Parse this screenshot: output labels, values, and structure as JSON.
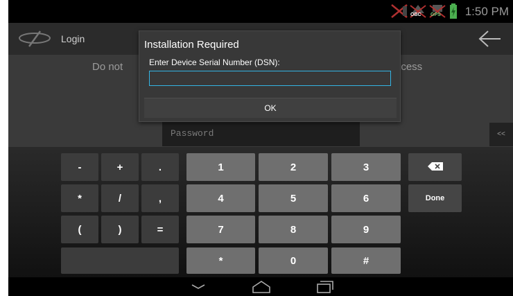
{
  "status_bar": {
    "time": "1:50 PM",
    "icons": [
      "signal-off-icon",
      "obc-icon",
      "gps-icon",
      "battery-icon"
    ],
    "obc_label": "OBC",
    "gps_label": "GPS"
  },
  "action_bar": {
    "title": "Login"
  },
  "content": {
    "hint_left": "Do not",
    "hint_right": "rocess",
    "password_placeholder": "Password",
    "collapse_label": "<<"
  },
  "dialog": {
    "title": "Installation Required",
    "prompt": "Enter Device Serial Number (DSN):",
    "input_value": "",
    "ok_label": "OK"
  },
  "keyboard": {
    "symbols": [
      "-",
      "+",
      ".",
      "*",
      "/",
      ",",
      "(",
      ")",
      "="
    ],
    "digits": [
      "1",
      "2",
      "3",
      "4",
      "5",
      "6",
      "7",
      "8",
      "9",
      "*",
      "0",
      "#"
    ],
    "done_label": "Done",
    "backspace_icon": "backspace-icon"
  },
  "nav_bar": {
    "icons": [
      "back-chevron-icon",
      "home-icon",
      "recent-apps-icon"
    ]
  },
  "colors": {
    "accent": "#33b5e5",
    "dialog_bg": "#383838",
    "key_light": "#6f6f6f",
    "key_dark": "#3c3c3c"
  }
}
